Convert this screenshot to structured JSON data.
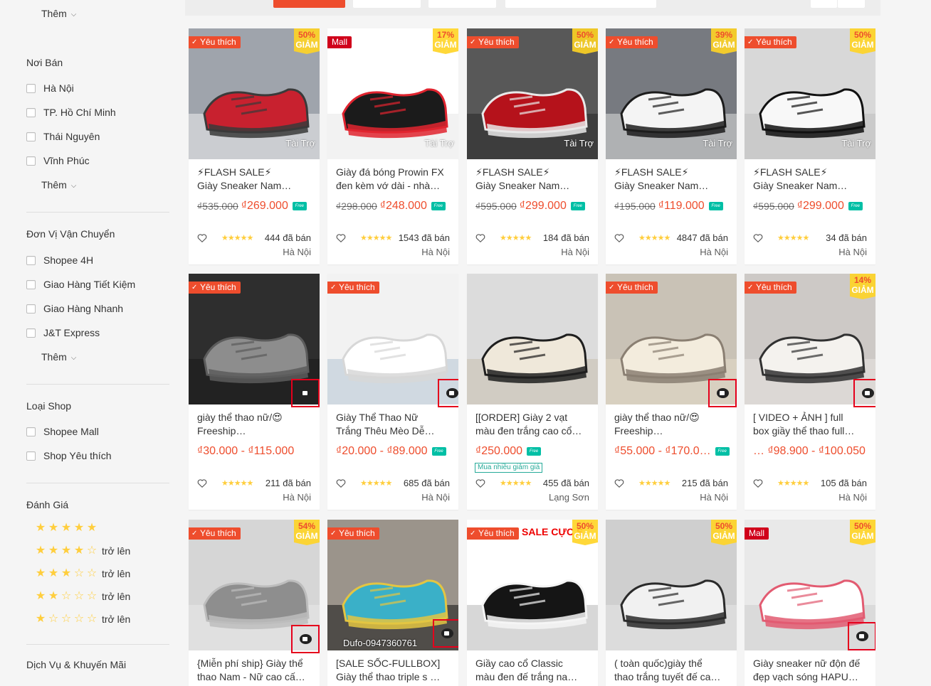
{
  "sidebar": {
    "more_label": "Thêm",
    "noi_ban": {
      "title": "Nơi Bán",
      "items": [
        "Hà Nội",
        "TP. Hồ Chí Minh",
        "Thái Nguyên",
        "Vĩnh Phúc"
      ]
    },
    "van_chuyen": {
      "title": "Đơn Vị Vận Chuyển",
      "items": [
        "Shopee 4H",
        "Giao Hàng Tiết Kiệm",
        "Giao Hàng Nhanh",
        "J&T Express"
      ]
    },
    "loai_shop": {
      "title": "Loại Shop",
      "items": [
        "Shopee Mall",
        "Shop Yêu thích"
      ]
    },
    "danh_gia": {
      "title": "Đánh Giá",
      "up_label": "trở lên",
      "levels": [
        5,
        4,
        3,
        2,
        1
      ]
    },
    "dich_vu": {
      "title": "Dịch Vụ & Khuyến Mãi"
    }
  },
  "badges": {
    "favorite": "Yêu thích",
    "mall": "Mall",
    "discount_word": "GIẢM",
    "sponsored": "Tài Trợ",
    "free_ship": "Free",
    "promo": "Mua nhiều giảm giá"
  },
  "colors": {
    "brand": "#ee4d2d",
    "star": "#ffce3d",
    "free_ship": "#00bfa5",
    "discount_bg": "#ffd424"
  },
  "products": [
    {
      "title1": "⚡FLASH SALE⚡",
      "title2": "Giày Sneaker Nam…",
      "old": "₫535.000",
      "price": "₫269.000",
      "sold": "444 đã bán",
      "loc": "Hà Nội",
      "disc": "50%",
      "img": "sneaker-red-grey"
    },
    {
      "title1": "Giày đá bóng Prowin FX",
      "title2": "đen kèm vớ dài - nhà…",
      "old": "₫298.000",
      "price": "₫248.000",
      "sold": "1543 đã bán",
      "loc": "Hà Nội",
      "disc": "17%",
      "img": "soccer-shoe-black"
    },
    {
      "title1": "⚡FLASH SALE⚡",
      "title2": "Giày Sneaker Nam…",
      "old": "₫595.000",
      "price": "₫299.000",
      "sold": "184 đã bán",
      "loc": "Hà Nội",
      "disc": "50%",
      "img": "sneaker-red"
    },
    {
      "title1": "⚡FLASH SALE⚡",
      "title2": "Giày Sneaker Nam…",
      "old": "₫195.000",
      "price": "₫119.000",
      "sold": "4847 đã bán",
      "loc": "Hà Nội",
      "disc": "39%",
      "img": "sneaker-white-offwhite"
    },
    {
      "title1": "⚡FLASH SALE⚡",
      "title2": "Giày Sneaker Nam…",
      "old": "₫595.000",
      "price": "₫299.000",
      "sold": "34 đã bán",
      "loc": "Hà Nội",
      "disc": "50%",
      "img": "sneaker-black-white"
    },
    {
      "title1": "giày thể thao nữ/😍",
      "title2": "Freeship…",
      "old": "",
      "price": "₫30.000 - ₫115.000",
      "sold": "211 đã bán",
      "loc": "Hà Nội",
      "disc": "",
      "img": "sneaker-grey-dark"
    },
    {
      "title1": "Giày Thể Thao Nữ",
      "title2": "Trắng Thêu Mèo Dễ…",
      "old": "",
      "price": "₫20.000 - ₫89.000",
      "sold": "685 đã bán",
      "loc": "Hà Nội",
      "disc": "",
      "img": "sneaker-white-cat"
    },
    {
      "title1": "[[ORDER] Giày 2 vạt",
      "title2": "màu đen trắng cao cổ…",
      "old": "",
      "price": "₫250.000",
      "sold": "455 đã bán",
      "loc": "Lạng Sơn",
      "disc": "",
      "img": "canvas-black-cream"
    },
    {
      "title1": "giày thể thao nữ/😍",
      "title2": "Freeship…",
      "old": "",
      "price": "₫55.000 - ₫170.0…",
      "sold": "215 đã bán",
      "loc": "Hà Nội",
      "disc": "",
      "img": "sneaker-cream-chunky"
    },
    {
      "title1": "[ VIDEO + ẢNH ] full",
      "title2": "box giầy thể thao full…",
      "old": "",
      "price": "… ₫98.900 - ₫100.050",
      "sold": "105 đã bán",
      "loc": "Hà Nội",
      "disc": "14%",
      "img": "sneaker-white-chunky"
    },
    {
      "title1": "{Miễn phí ship} Giày thể",
      "title2": "thao Nam - Nữ cao cấ…",
      "old": "",
      "price": "",
      "sold": "",
      "loc": "",
      "disc": "54%",
      "img": "sneaker-grey-knit"
    },
    {
      "title1": "[SALE SỐC-FULLBOX]",
      "title2": "Giày thể thao triple s …",
      "old": "",
      "price": "",
      "sold": "",
      "loc": "",
      "disc": "",
      "img": "triple-s-stack",
      "watermark": "Dufo-0947360761"
    },
    {
      "title1": "Giầy cao cổ Classic",
      "title2": "màu đen đế trắng na…",
      "old": "",
      "price": "",
      "sold": "",
      "loc": "",
      "disc": "50%",
      "img": "converse-black",
      "sale_text": "SALE CỰC S"
    },
    {
      "title1": "( toàn quốc)giày thể",
      "title2": "thao trắng tuyết đế ca…",
      "old": "",
      "price": "",
      "sold": "",
      "loc": "",
      "disc": "50%",
      "img": "sneaker-white-hand"
    },
    {
      "title1": "Giày sneaker nữ độn đế",
      "title2": "đẹp vạch sóng HAPU…",
      "old": "",
      "price": "",
      "sold": "",
      "loc": "",
      "disc": "50%",
      "img": "sneaker-white-pink"
    }
  ]
}
